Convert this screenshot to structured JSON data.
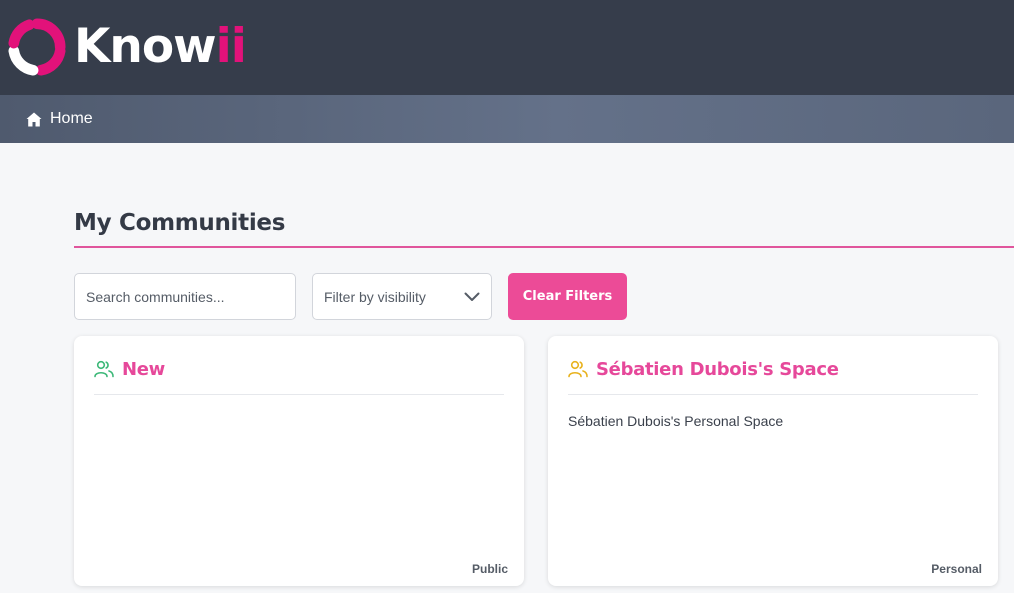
{
  "brand": {
    "name_main": "Know",
    "name_accent": "ii",
    "accent_color": "#e2127a"
  },
  "nav": {
    "home_label": "Home",
    "home_icon": "home-icon"
  },
  "page": {
    "title": "My Communities"
  },
  "filters": {
    "search_placeholder": "Search communities...",
    "visibility_placeholder": "Filter by visibility",
    "clear_label": "Clear Filters"
  },
  "communities": [
    {
      "title": "New",
      "description": "",
      "visibility": "Public",
      "icon": "users-icon",
      "icon_color": "#3cb878"
    },
    {
      "title": "Sébatien Dubois's Space",
      "description": "Sébatien Dubois's Personal Space",
      "visibility": "Personal",
      "icon": "users-icon",
      "icon_color": "#e8b21e"
    }
  ],
  "colors": {
    "header_bg": "#363d4b",
    "primary": "#ec4b97"
  }
}
